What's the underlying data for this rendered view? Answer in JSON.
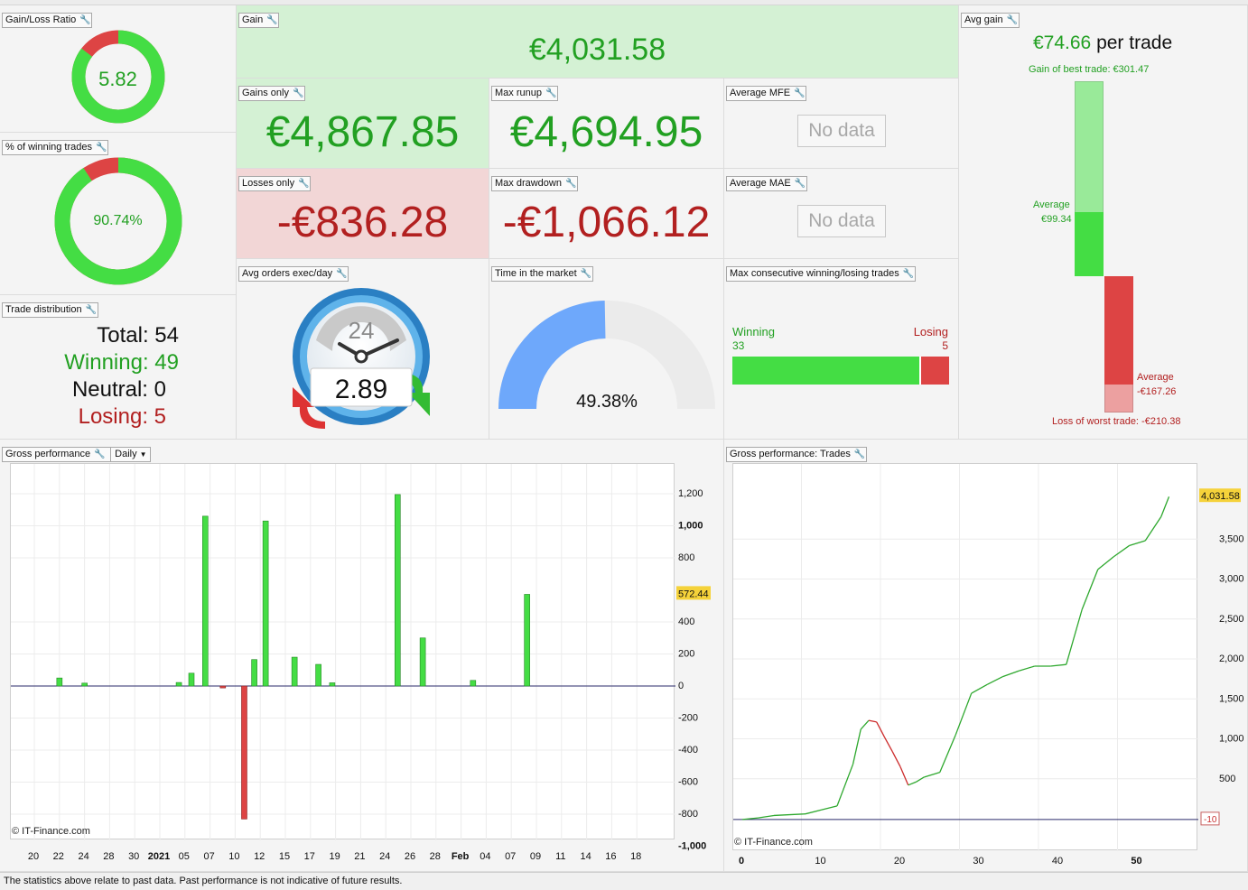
{
  "panels": {
    "gain_loss_ratio": {
      "title": "Gain/Loss Ratio",
      "value": "5.82",
      "fraction_green": 0.853
    },
    "winning_pct": {
      "title": "% of winning trades",
      "value": "90.74%",
      "fraction_green": 0.9074
    },
    "trade_distribution": {
      "title": "Trade distribution",
      "total": "Total: 54",
      "winning": "Winning: 49",
      "neutral": "Neutral: 0",
      "losing": "Losing: 5"
    },
    "gain": {
      "title": "Gain",
      "value": "€4,031.58"
    },
    "gains_only": {
      "title": "Gains only",
      "value": "€4,867.85"
    },
    "losses_only": {
      "title": "Losses only",
      "value": "-€836.28"
    },
    "max_runup": {
      "title": "Max runup",
      "value": "€4,694.95"
    },
    "max_drawdown": {
      "title": "Max drawdown",
      "value": "-€1,066.12"
    },
    "average_mfe": {
      "title": "Average MFE",
      "value": "No data"
    },
    "average_mae": {
      "title": "Average MAE",
      "value": "No data"
    },
    "avg_orders": {
      "title": "Avg orders exec/day",
      "value": "2.89",
      "dial_label": "24"
    },
    "time_in_market": {
      "title": "Time in the market",
      "value": "49.38%",
      "fraction": 0.4938
    },
    "max_consecutive": {
      "title": "Max consecutive winning/losing trades",
      "winning_label": "Winning",
      "winning_value": "33",
      "losing_label": "Losing",
      "losing_value": "5",
      "winning": 33,
      "losing": 5
    },
    "avg_gain": {
      "title": "Avg gain",
      "headline_value": "€74.66",
      "headline_suffix": " per trade",
      "best_label": "Gain of best trade: €301.47",
      "avg_win_label": "Average",
      "avg_win_value": "€99.34",
      "avg_loss_label": "Average",
      "avg_loss_value": "-€167.26",
      "worst_label": "Loss of worst trade: -€210.38",
      "best": 301.47,
      "avg_win": 99.34,
      "avg_loss": -167.26,
      "worst": -210.38
    },
    "gross_daily": {
      "title": "Gross performance",
      "dropdown": "Daily",
      "watermark": "© IT-Finance.com"
    },
    "gross_trades": {
      "title": "Gross performance: Trades",
      "watermark": "© IT-Finance.com"
    }
  },
  "footer": "The statistics above relate to past data. Past performance is not indicative of future results.",
  "colors": {
    "green": "#44dd44",
    "red": "#dd4444",
    "blue_gauge": "#6ea8fb",
    "label_highlight": "#f5d23a"
  },
  "chart_data": [
    {
      "type": "bar",
      "name": "gross-daily",
      "x_ticks": [
        "20",
        "22",
        "24",
        "28",
        "30",
        "2021",
        "05",
        "07",
        "10",
        "12",
        "15",
        "17",
        "19",
        "21",
        "24",
        "26",
        "28",
        "Feb",
        "04",
        "07",
        "09",
        "11",
        "14",
        "16",
        "18"
      ],
      "ylim": [
        -1000,
        1400
      ],
      "y_ticks": [
        "1,200",
        "1,000",
        "800",
        "400",
        "200",
        "0",
        "-200",
        "-400",
        "-600",
        "-800",
        "-1,000"
      ],
      "y_tick_values": [
        1200,
        1000,
        800,
        400,
        200,
        0,
        -200,
        -400,
        -600,
        -800,
        -1000
      ],
      "last_value_label": "572.44",
      "last_value": 572.44,
      "bars": [
        {
          "x": 22,
          "v": 50
        },
        {
          "x": 24,
          "v": 18
        },
        {
          "x": 31.5,
          "v": 22
        },
        {
          "x": 32.5,
          "v": 80
        },
        {
          "x": 33.6,
          "v": 1060
        },
        {
          "x": 35,
          "v": -12
        },
        {
          "x": 36.7,
          "v": -830
        },
        {
          "x": 37.5,
          "v": 165
        },
        {
          "x": 38.4,
          "v": 1030
        },
        {
          "x": 40.7,
          "v": 180
        },
        {
          "x": 42.6,
          "v": 135
        },
        {
          "x": 43.7,
          "v": 20
        },
        {
          "x": 48.9,
          "v": 1195
        },
        {
          "x": 50.9,
          "v": 300
        },
        {
          "x": 54.9,
          "v": 35
        },
        {
          "x": 59.2,
          "v": 572
        }
      ]
    },
    {
      "type": "line",
      "name": "gross-trades",
      "x_ticks": [
        "0",
        "10",
        "20",
        "30",
        "40",
        "50"
      ],
      "x_tick_values": [
        0,
        10,
        20,
        30,
        40,
        50
      ],
      "ylim": [
        -150,
        4350
      ],
      "y_ticks": [
        "3,500",
        "3,000",
        "2,500",
        "2,000",
        "1,500",
        "1,000",
        "500"
      ],
      "y_tick_values": [
        3500,
        3000,
        2500,
        2000,
        1500,
        1000,
        500
      ],
      "last_value_label": "4,031.58",
      "last_value": 4031.58,
      "baseline_label": "-10",
      "baseline_value": -10,
      "points": [
        [
          0,
          -10
        ],
        [
          2,
          10
        ],
        [
          4,
          40
        ],
        [
          6,
          50
        ],
        [
          8,
          60
        ],
        [
          10,
          110
        ],
        [
          12,
          160
        ],
        [
          14,
          680
        ],
        [
          15,
          1120
        ],
        [
          16,
          1230
        ],
        [
          17,
          1210
        ],
        [
          18,
          1020
        ],
        [
          19,
          840
        ],
        [
          20,
          650
        ],
        [
          21,
          420
        ],
        [
          22,
          460
        ],
        [
          23,
          520
        ],
        [
          25,
          580
        ],
        [
          27,
          1050
        ],
        [
          29,
          1570
        ],
        [
          31,
          1680
        ],
        [
          33,
          1780
        ],
        [
          35,
          1850
        ],
        [
          37,
          1910
        ],
        [
          39,
          1910
        ],
        [
          41,
          1930
        ],
        [
          43,
          2620
        ],
        [
          45,
          3120
        ],
        [
          47,
          3280
        ],
        [
          49,
          3420
        ],
        [
          51,
          3480
        ],
        [
          53,
          3780
        ],
        [
          54,
          4031.58
        ]
      ],
      "red_segment": [
        16,
        21
      ]
    }
  ]
}
